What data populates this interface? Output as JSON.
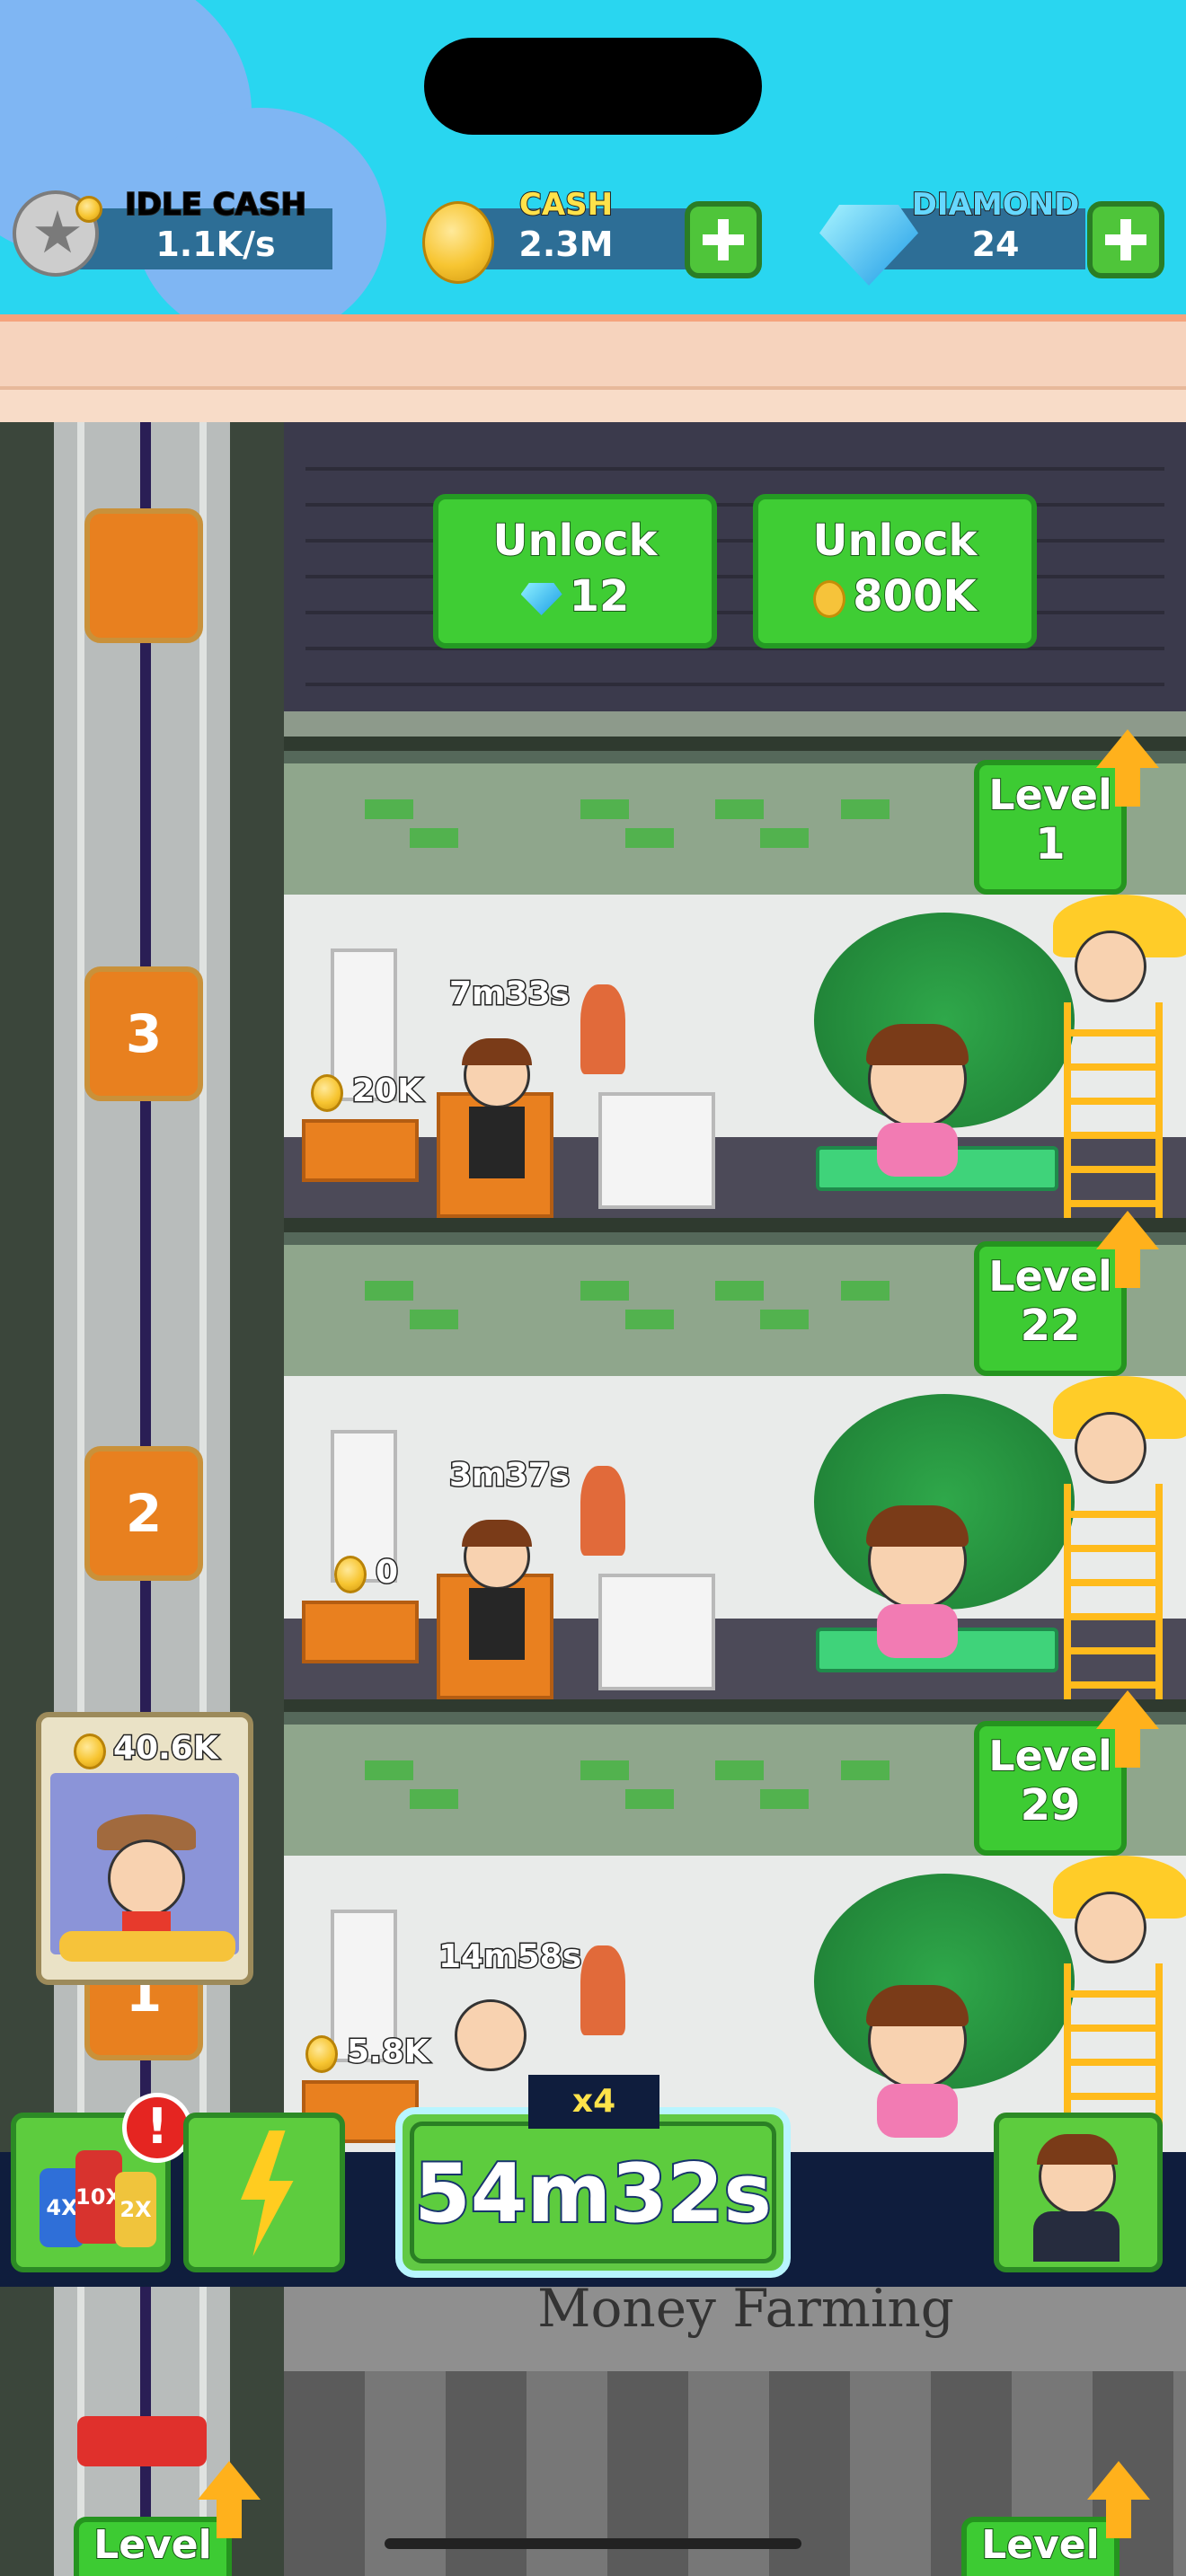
{
  "stats": {
    "idle_cash": {
      "label": "IDLE CASH",
      "value": "1.1K/s",
      "label_color": "#e55ef5"
    },
    "cash": {
      "label": "CASH",
      "value": "2.3M",
      "label_color": "#ffe24a"
    },
    "diamond": {
      "label": "DIAMOND",
      "value": "24",
      "label_color": "#66d8ff"
    }
  },
  "unlock": {
    "gem_button": {
      "title": "Unlock",
      "cost": "12"
    },
    "coin_button": {
      "title": "Unlock",
      "cost": "800K"
    }
  },
  "floors": [
    {
      "number": "3",
      "level_label": "Level",
      "level": "1",
      "timer": "7m33s",
      "earnings": "20K"
    },
    {
      "number": "2",
      "level_label": "Level",
      "level": "22",
      "timer": "3m37s",
      "earnings": "0"
    },
    {
      "number": "1",
      "level_label": "Level",
      "level": "29",
      "timer": "14m58s",
      "earnings": "5.8K"
    }
  ],
  "elevator_worker": {
    "amount": "40.6K"
  },
  "boost": {
    "multiplier": "x4",
    "timer": "54m32s"
  },
  "booster_labels": [
    "4X",
    "10X",
    "2X"
  ],
  "alert_symbol": "!",
  "shop_sign": "Money Farming",
  "bottom_levels": {
    "left": "Level",
    "right": "Level"
  },
  "colors": {
    "sky": "#29d6f0",
    "green_button": "#3fcd34",
    "floor_button": "#e8801f",
    "bar": "#0f1d3d"
  },
  "icons": [
    "star-icon",
    "coin-icon",
    "diamond-icon",
    "plus-icon",
    "up-arrow-icon",
    "lightning-icon",
    "manager-icon",
    "booster-bottles-icon"
  ]
}
